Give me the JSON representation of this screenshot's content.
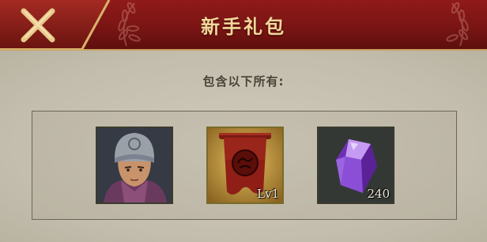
{
  "header": {
    "title": "新手礼包"
  },
  "content": {
    "subtitle": "包含以下所有:"
  },
  "items": [
    {
      "name": "general-portrait",
      "count": ""
    },
    {
      "name": "banner",
      "count": "Lv1"
    },
    {
      "name": "purple-gem",
      "count": "240"
    }
  ],
  "colors": {
    "header_red": "#7a1514",
    "title_gold": "#f3d89a",
    "gem_purple": "#8a4fd6"
  }
}
